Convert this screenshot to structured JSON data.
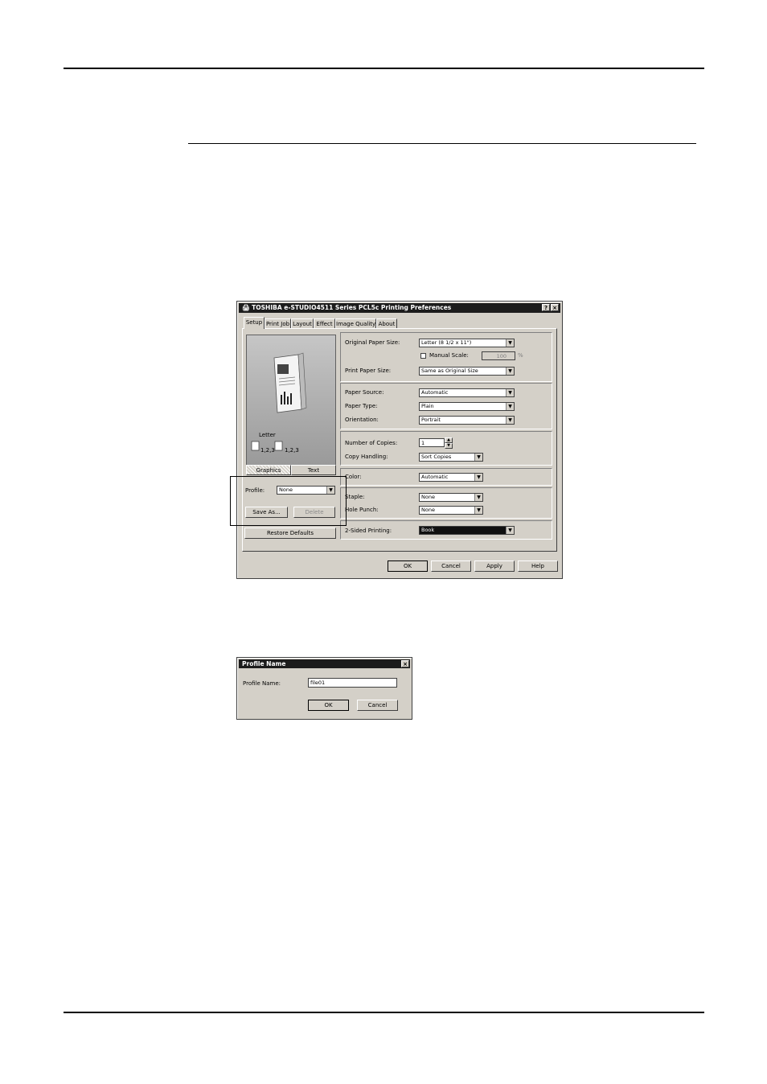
{
  "main_dialog": {
    "title": "TOSHIBA e-STUDIO4511 Series PCL5c Printing Preferences",
    "help_btn": "?",
    "close_btn": "×",
    "tabs": [
      "Setup",
      "Print Job",
      "Layout",
      "Effect",
      "Image Quality",
      "About"
    ],
    "active_tab": "Setup",
    "preview": {
      "paper_label": "Letter",
      "collate_a": "1,2,3",
      "collate_b": "1,2,3",
      "view_tabs": [
        "Graphics",
        "Text"
      ]
    },
    "profile": {
      "label": "Profile:",
      "value": "None"
    },
    "save_as_label": "Save As...",
    "delete_label": "Delete",
    "restore_defaults_label": "Restore Defaults",
    "original_paper_size": {
      "label": "Original Paper Size:",
      "value": "Letter (8 1/2 x 11\")"
    },
    "manual_scale": {
      "label": "Manual Scale:",
      "value": "100",
      "unit": "%",
      "checked": false
    },
    "print_paper_size": {
      "label": "Print Paper Size:",
      "value": "Same as Original Size"
    },
    "paper_source": {
      "label": "Paper Source:",
      "value": "Automatic"
    },
    "paper_type": {
      "label": "Paper Type:",
      "value": "Plain"
    },
    "orientation": {
      "label": "Orientation:",
      "value": "Portrait"
    },
    "number_of_copies": {
      "label": "Number of Copies:",
      "value": "1"
    },
    "copy_handling": {
      "label": "Copy Handling:",
      "value": "Sort Copies"
    },
    "color": {
      "label": "Color:",
      "value": "Automatic"
    },
    "staple": {
      "label": "Staple:",
      "value": "None"
    },
    "hole_punch": {
      "label": "Hole Punch:",
      "value": "None"
    },
    "two_sided": {
      "label": "2-Sided Printing:",
      "value": "Book"
    },
    "buttons": {
      "ok": "OK",
      "cancel": "Cancel",
      "apply": "Apply",
      "help": "Help"
    }
  },
  "profile_dialog": {
    "title": "Profile Name",
    "close_btn": "×",
    "field_label": "Profile Name:",
    "field_value": "file01",
    "ok": "OK",
    "cancel": "Cancel"
  },
  "colors": {
    "titlebar": "#1c1c1c",
    "dialog_face": "#d4d0c8"
  }
}
